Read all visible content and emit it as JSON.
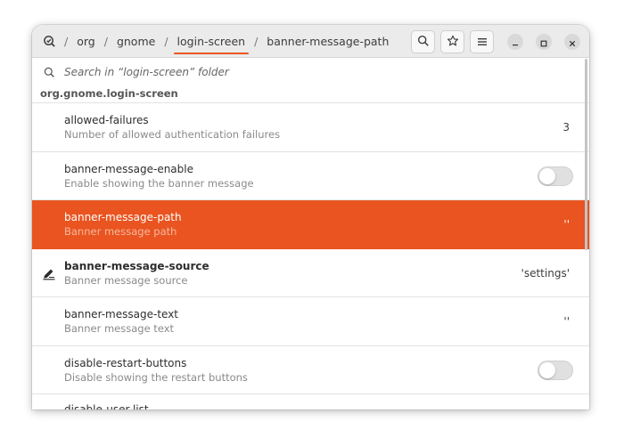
{
  "header": {
    "breadcrumbs": [
      "org",
      "gnome",
      "login-screen",
      "banner-message-path"
    ],
    "active_crumb_index": 2
  },
  "search": {
    "placeholder": "Search in “login-screen” folder"
  },
  "group_title": "org.gnome.login-screen",
  "rows": [
    {
      "name": "allowed-failures",
      "desc": "Number of allowed authentication failures",
      "value": "3"
    },
    {
      "name": "banner-message-enable",
      "desc": "Enable showing the banner message",
      "toggle": false
    },
    {
      "name": "banner-message-path",
      "desc": "Banner message path",
      "value": "''",
      "selected": true
    },
    {
      "name": "banner-message-source",
      "desc": "Banner message source",
      "value": "'settings'",
      "modified": true
    },
    {
      "name": "banner-message-text",
      "desc": "Banner message text",
      "value": "''"
    },
    {
      "name": "disable-restart-buttons",
      "desc": "Disable showing the restart buttons",
      "toggle": false
    },
    {
      "name": "disable-user-list",
      "desc": "",
      "value": ""
    }
  ],
  "icons": {
    "home": "dconf-home-icon",
    "search": "search-icon",
    "bookmark": "star-icon",
    "menu": "hamburger-menu-icon",
    "minimize": "minimize-icon",
    "maximize": "maximize-icon",
    "close": "close-icon",
    "modified": "pencil-edit-icon"
  },
  "colors": {
    "accent": "#e95420"
  }
}
